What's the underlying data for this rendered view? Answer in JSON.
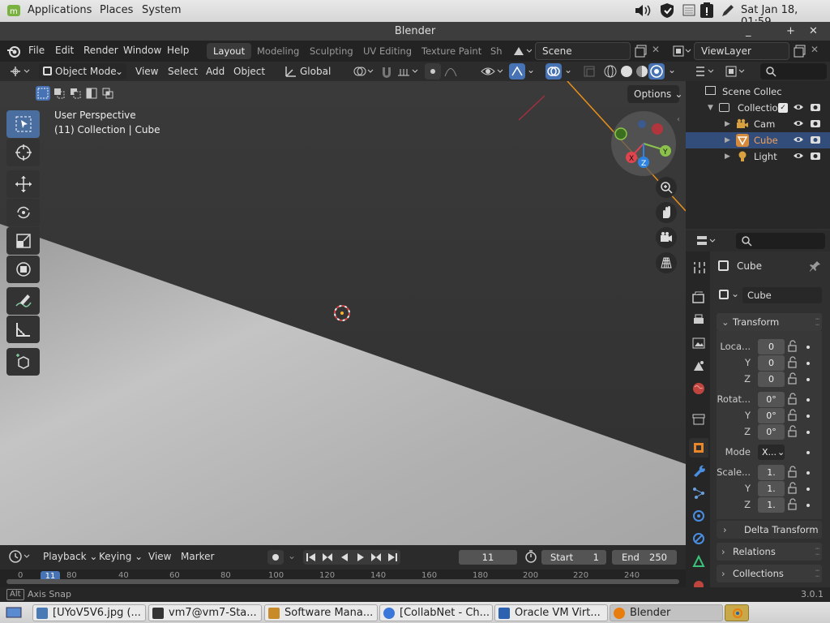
{
  "system_bar": {
    "menus": [
      "Applications",
      "Places",
      "System"
    ],
    "clock": "Sat Jan 18, 01:59"
  },
  "window": {
    "title": "Blender"
  },
  "topbar": {
    "menus": [
      "File",
      "Edit",
      "Render",
      "Window",
      "Help"
    ],
    "workspaces": [
      "Layout",
      "Modeling",
      "Sculpting",
      "UV Editing",
      "Texture Paint",
      "Sh"
    ],
    "active_workspace": "Layout",
    "scene": "Scene",
    "view_layer": "ViewLayer"
  },
  "viewport_header": {
    "mode": "Object Mode",
    "menus": [
      "View",
      "Select",
      "Add",
      "Object"
    ],
    "orientation": "Global",
    "options_label": "Options"
  },
  "viewport": {
    "perspective": "User Perspective",
    "collection_info": "(11) Collection | Cube",
    "gizmo_axes": [
      "X",
      "Y",
      "Z"
    ]
  },
  "outliner": {
    "items": [
      {
        "label": "Scene Collec",
        "icon": "scene-collection-icon",
        "indent": 0
      },
      {
        "label": "Collectio",
        "icon": "collection-icon",
        "indent": 1
      },
      {
        "label": "Cam",
        "icon": "camera-icon",
        "indent": 2
      },
      {
        "label": "Cube",
        "icon": "mesh-icon",
        "indent": 2,
        "selected": true
      },
      {
        "label": "Light",
        "icon": "light-icon",
        "indent": 2
      }
    ]
  },
  "properties": {
    "object_name": "Cube",
    "data_name": "Cube",
    "transform_label": "Transform",
    "location": {
      "label": "Loca...",
      "x": "0",
      "y": "0",
      "z": "0"
    },
    "rotation": {
      "label": "Rotat...",
      "x": "0°",
      "y": "0°",
      "z": "0°"
    },
    "mode": {
      "label": "Mode",
      "value": "X..."
    },
    "scale": {
      "label": "Scale...",
      "x": "1.",
      "y": "1.",
      "z": "1."
    },
    "axis_y": "Y",
    "axis_z": "Z",
    "subpanels": [
      "Delta Transform",
      "Relations",
      "Collections"
    ]
  },
  "timeline": {
    "menus": [
      "Playback",
      "Keying",
      "View",
      "Marker"
    ],
    "current_frame": "11",
    "start_label": "Start",
    "start": "1",
    "end_label": "End",
    "end": "250",
    "ruler": [
      "0",
      "11",
      "80",
      "40",
      "60",
      "80",
      "100",
      "120",
      "140",
      "160",
      "180",
      "200",
      "220",
      "240"
    ]
  },
  "status_bar": {
    "key": "Alt",
    "hint": "Axis Snap",
    "version": "3.0.1"
  },
  "taskbar": {
    "items": [
      {
        "label": "[UYoV5V6.jpg (...",
        "color": "#4a7ab5"
      },
      {
        "label": "vm7@vm7-Sta...",
        "color": "#333"
      },
      {
        "label": "Software Mana...",
        "color": "#c98a2a"
      },
      {
        "label": "[CollabNet - Ch...",
        "color": "#3a77d8"
      },
      {
        "label": "Oracle VM Virt...",
        "color": "#2c62b0"
      },
      {
        "label": "Blender",
        "color": "#e87d0d"
      }
    ]
  },
  "colors": {
    "accent": "#4772b3",
    "blender_orange": "#e87d0d",
    "axis_x": "#e0444e",
    "axis_y": "#8bc34a",
    "axis_z": "#2f83e0"
  }
}
